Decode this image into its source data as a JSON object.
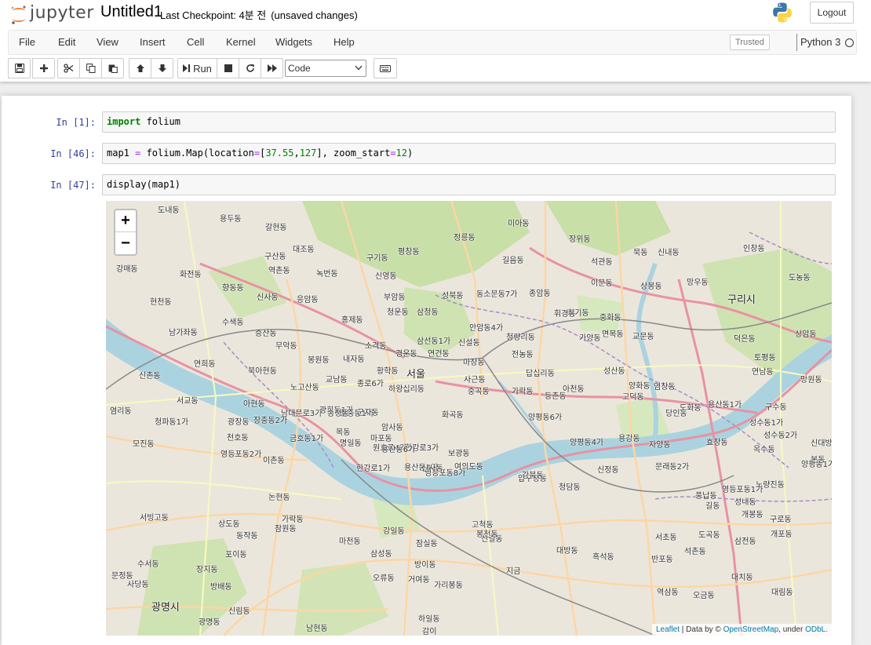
{
  "header": {
    "logo_text": "jupyter",
    "notebook_name": "Untitled1",
    "checkpoint": "Last Checkpoint: 4분 전",
    "save_status": "(unsaved changes)",
    "logout_label": "Logout"
  },
  "menubar": {
    "items": [
      "File",
      "Edit",
      "View",
      "Insert",
      "Cell",
      "Kernel",
      "Widgets",
      "Help"
    ],
    "trusted_label": "Trusted",
    "kernel_name": "Python 3"
  },
  "toolbar": {
    "run_label": "Run",
    "cell_type": "Code"
  },
  "cells": [
    {
      "prompt": "In [1]:",
      "tokens": [
        {
          "t": "import",
          "c": "kw"
        },
        {
          "t": " folium",
          "c": ""
        }
      ]
    },
    {
      "prompt": "In [46]:",
      "tokens": [
        {
          "t": "map1 ",
          "c": ""
        },
        {
          "t": "=",
          "c": "op"
        },
        {
          "t": " folium.Map(location",
          "c": ""
        },
        {
          "t": "=",
          "c": "op"
        },
        {
          "t": "[",
          "c": ""
        },
        {
          "t": "37.55",
          "c": "num"
        },
        {
          "t": ",",
          "c": ""
        },
        {
          "t": "127",
          "c": "num"
        },
        {
          "t": "], zoom_start",
          "c": ""
        },
        {
          "t": "=",
          "c": "op"
        },
        {
          "t": "12",
          "c": "num"
        },
        {
          "t": ")",
          "c": ""
        }
      ]
    },
    {
      "prompt": "In [47]:",
      "tokens": [
        {
          "t": "display(map1)",
          "c": ""
        }
      ]
    }
  ],
  "map": {
    "zoom_in": "+",
    "zoom_out": "−",
    "attribution": {
      "leaflet": "Leaflet",
      "data_by": " | Data by © ",
      "osm": "OpenStreetMap",
      "under": ", under ",
      "odbl": "ODbL."
    },
    "places": [
      {
        "name": "서울",
        "big": true
      },
      {
        "name": "구리시",
        "big": true
      },
      {
        "name": "광명시",
        "big": true
      },
      {
        "name": "도내동"
      },
      {
        "name": "용두동"
      },
      {
        "name": "갈현동"
      },
      {
        "name": "대조동"
      },
      {
        "name": "구산동"
      },
      {
        "name": "역촌동"
      },
      {
        "name": "녹번동"
      },
      {
        "name": "구기동"
      },
      {
        "name": "평창동"
      },
      {
        "name": "정릉동"
      },
      {
        "name": "미아동"
      },
      {
        "name": "장위동"
      },
      {
        "name": "석관동"
      },
      {
        "name": "묵동"
      },
      {
        "name": "신내동"
      },
      {
        "name": "인창동"
      },
      {
        "name": "강매동"
      },
      {
        "name": "화전동"
      },
      {
        "name": "향동동"
      },
      {
        "name": "신사동"
      },
      {
        "name": "응암동"
      },
      {
        "name": "신영동"
      },
      {
        "name": "부암동"
      },
      {
        "name": "성북동"
      },
      {
        "name": "종암동"
      },
      {
        "name": "길음동"
      },
      {
        "name": "이문동"
      },
      {
        "name": "상봉동"
      },
      {
        "name": "망우동"
      },
      {
        "name": "도농동"
      },
      {
        "name": "현천동"
      },
      {
        "name": "수색동"
      },
      {
        "name": "증산동"
      },
      {
        "name": "홍제동"
      },
      {
        "name": "청운동"
      },
      {
        "name": "삼청동"
      },
      {
        "name": "동소문동7가"
      },
      {
        "name": "회기동"
      },
      {
        "name": "중화동"
      },
      {
        "name": "덕은동"
      },
      {
        "name": "남가좌동"
      },
      {
        "name": "무악동"
      },
      {
        "name": "소격동"
      },
      {
        "name": "삼선동1가"
      },
      {
        "name": "안암동4가"
      },
      {
        "name": "청량리동"
      },
      {
        "name": "휘경동"
      },
      {
        "name": "면목동"
      },
      {
        "name": "교문동"
      },
      {
        "name": "토평동"
      },
      {
        "name": "상암동"
      },
      {
        "name": "연희동"
      },
      {
        "name": "봉원동"
      },
      {
        "name": "내자동"
      },
      {
        "name": "경운동"
      },
      {
        "name": "연건동"
      },
      {
        "name": "신설동"
      },
      {
        "name": "전농동"
      },
      {
        "name": "가양동"
      },
      {
        "name": "성산동"
      },
      {
        "name": "신촌동"
      },
      {
        "name": "북아현동"
      },
      {
        "name": "교남동"
      },
      {
        "name": "종로6가"
      },
      {
        "name": "황학동"
      },
      {
        "name": "마장동"
      },
      {
        "name": "답십리동"
      },
      {
        "name": "아천동"
      },
      {
        "name": "고덕동"
      },
      {
        "name": "염창동"
      },
      {
        "name": "연남동"
      },
      {
        "name": "망원동"
      },
      {
        "name": "서교동"
      },
      {
        "name": "노고산동"
      },
      {
        "name": "아현동"
      },
      {
        "name": "남대문로3가"
      },
      {
        "name": "광희동1가"
      },
      {
        "name": "창충동1가"
      },
      {
        "name": "하왕십리동"
      },
      {
        "name": "사근동"
      },
      {
        "name": "중곡동"
      },
      {
        "name": "가락동"
      },
      {
        "name": "등촌동"
      },
      {
        "name": "양화동"
      },
      {
        "name": "당인동"
      },
      {
        "name": "구수동"
      },
      {
        "name": "염리동"
      },
      {
        "name": "청파동1가"
      },
      {
        "name": "장충동2가"
      },
      {
        "name": "금호동1가"
      },
      {
        "name": "송정동"
      },
      {
        "name": "군자동"
      },
      {
        "name": "암사동"
      },
      {
        "name": "화곡동"
      },
      {
        "name": "양평동6가"
      },
      {
        "name": "양평동4가"
      },
      {
        "name": "용강동"
      },
      {
        "name": "도화동"
      },
      {
        "name": "효창동"
      },
      {
        "name": "용산동1가"
      },
      {
        "name": "옥수동"
      },
      {
        "name": "성수동1가"
      },
      {
        "name": "성수동2가"
      },
      {
        "name": "모진동"
      },
      {
        "name": "광장동"
      },
      {
        "name": "천호동"
      },
      {
        "name": "명일동"
      },
      {
        "name": "목동"
      },
      {
        "name": "마포동"
      },
      {
        "name": "한강로1가"
      },
      {
        "name": "영등포동8가"
      },
      {
        "name": "여의도동"
      },
      {
        "name": "원효로4가"
      },
      {
        "name": "한강로3가"
      },
      {
        "name": "용산동4가"
      },
      {
        "name": "보광동"
      },
      {
        "name": "압구정동"
      },
      {
        "name": "청담동"
      },
      {
        "name": "자양동"
      },
      {
        "name": "풍납동"
      },
      {
        "name": "성내동"
      },
      {
        "name": "길동"
      },
      {
        "name": "양평동1가"
      },
      {
        "name": "영등포동2가"
      },
      {
        "name": "이촌동"
      },
      {
        "name": "용산동6가"
      },
      {
        "name": "신사동"
      },
      {
        "name": "강북동"
      },
      {
        "name": "신정동"
      },
      {
        "name": "문래동2가"
      },
      {
        "name": "영등포동1가"
      },
      {
        "name": "노량진동"
      },
      {
        "name": "본동"
      },
      {
        "name": "서빙고동"
      },
      {
        "name": "잠원동"
      },
      {
        "name": "논현동"
      },
      {
        "name": "삼성동"
      },
      {
        "name": "잠실동"
      },
      {
        "name": "방이동"
      },
      {
        "name": "강일동"
      },
      {
        "name": "고척동"
      },
      {
        "name": "신길동"
      },
      {
        "name": "대방동"
      },
      {
        "name": "흑석동"
      },
      {
        "name": "반포동"
      },
      {
        "name": "역삼동"
      },
      {
        "name": "대치동"
      },
      {
        "name": "삼전동"
      },
      {
        "name": "석촌동"
      },
      {
        "name": "오금동"
      },
      {
        "name": "개봉동"
      },
      {
        "name": "구로동"
      },
      {
        "name": "대림동"
      },
      {
        "name": "신대방동"
      },
      {
        "name": "상도동"
      },
      {
        "name": "동작동"
      },
      {
        "name": "가락동"
      },
      {
        "name": "마천동"
      },
      {
        "name": "오류동"
      },
      {
        "name": "거여동"
      },
      {
        "name": "가리봉동"
      },
      {
        "name": "봉천동"
      },
      {
        "name": "서초동"
      },
      {
        "name": "도곡동"
      },
      {
        "name": "개포동"
      },
      {
        "name": "수서동"
      },
      {
        "name": "문정동"
      },
      {
        "name": "사당동"
      },
      {
        "name": "방배동"
      },
      {
        "name": "포이동"
      },
      {
        "name": "장지동"
      },
      {
        "name": "광명동"
      },
      {
        "name": "신림동"
      },
      {
        "name": "남현동"
      },
      {
        "name": "하일동"
      },
      {
        "name": "감이"
      },
      {
        "name": "지금"
      }
    ]
  }
}
